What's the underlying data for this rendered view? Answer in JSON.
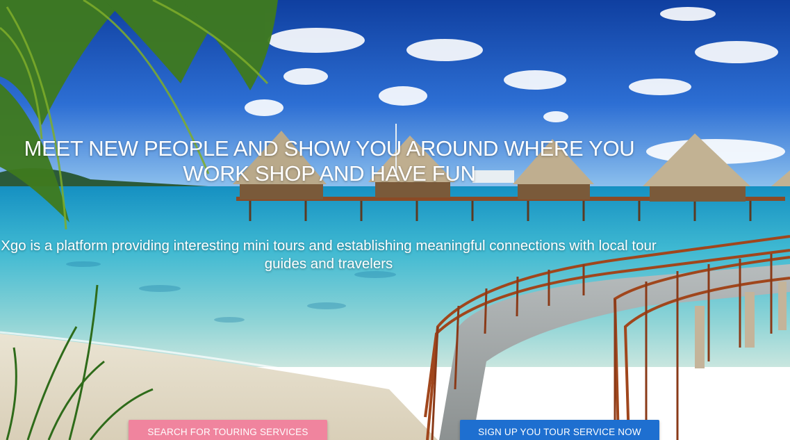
{
  "hero": {
    "headline": "MEET NEW PEOPLE AND SHOW YOU AROUND WHERE YOU WORK SHOP AND HAVE FUN",
    "tagline": "Xgo is a platform providing interesting mini tours and establishing meaningful connections with local tour guides and travelers",
    "background_icon": "tropical-beach-overwater-bungalows-image"
  },
  "actions": {
    "search_label": "SEARCH FOR TOURING SERVICES",
    "signup_label": "SIGN UP YOU TOUR SERVICE NOW"
  },
  "colors": {
    "search_button": "#f0849e",
    "signup_button": "#1e6fd0",
    "text": "#ffffff"
  }
}
